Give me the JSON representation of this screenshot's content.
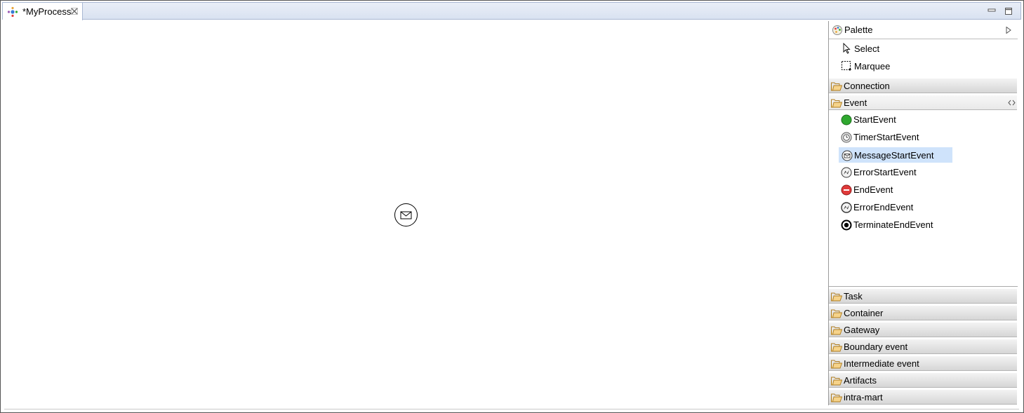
{
  "editor": {
    "tab_title": "*MyProcess",
    "icons": {
      "tab": "process-icon",
      "close": "close-icon",
      "minimize": "minimize-icon",
      "maximize": "maximize-icon"
    }
  },
  "canvas": {
    "elements": [
      {
        "type": "message-start-event",
        "icon": "envelope-icon"
      }
    ]
  },
  "palette": {
    "title": "Palette",
    "tools": [
      {
        "label": "Select",
        "icon": "arrow-pointer-icon"
      },
      {
        "label": "Marquee",
        "icon": "marquee-icon"
      }
    ],
    "drawers": {
      "connection": "Connection",
      "event": "Event",
      "task": "Task",
      "container": "Container",
      "gateway": "Gateway",
      "boundary_event": "Boundary event",
      "intermediate_event": "Intermediate event",
      "artifacts": "Artifacts",
      "intra_mart": "intra-mart"
    },
    "event_items": [
      {
        "label": "StartEvent",
        "icon": "start-event-icon",
        "selected": false
      },
      {
        "label": "TimerStartEvent",
        "icon": "timer-start-event-icon",
        "selected": false
      },
      {
        "label": "MessageStartEvent",
        "icon": "message-start-event-icon",
        "selected": true
      },
      {
        "label": "ErrorStartEvent",
        "icon": "error-start-event-icon",
        "selected": false
      },
      {
        "label": "EndEvent",
        "icon": "end-event-icon",
        "selected": false
      },
      {
        "label": "ErrorEndEvent",
        "icon": "error-end-event-icon",
        "selected": false
      },
      {
        "label": "TerminateEndEvent",
        "icon": "terminate-end-event-icon",
        "selected": false
      }
    ],
    "colors": {
      "selection": "#cfe3fb",
      "start_event": "#2fa82f",
      "end_event": "#e03a3a",
      "folder": "#e8a53a"
    }
  }
}
